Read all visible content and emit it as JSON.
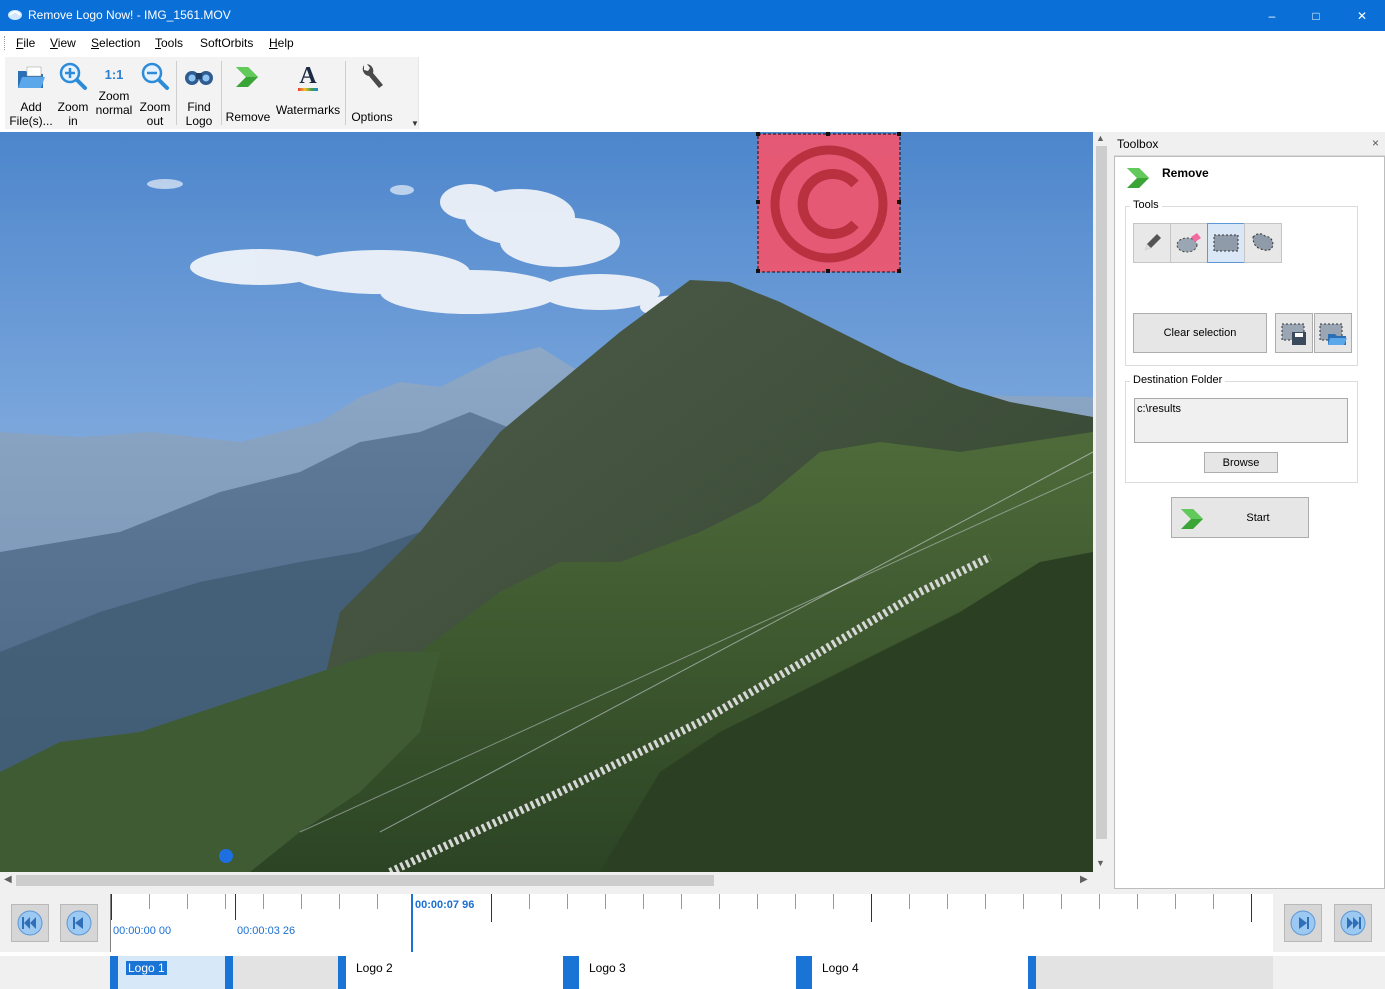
{
  "window": {
    "title": "Remove Logo Now! - IMG_1561.MOV",
    "minimize": "–",
    "maximize": "□",
    "close": "✕"
  },
  "menu": {
    "items": [
      {
        "label": "File",
        "key": "F",
        "rest": "ile"
      },
      {
        "label": "View",
        "key": "V",
        "rest": "iew"
      },
      {
        "label": "Selection",
        "key": "S",
        "rest": "election"
      },
      {
        "label": "Tools",
        "key": "T",
        "rest": "ools"
      },
      {
        "label": "SoftOrbits",
        "key": "",
        "rest": "SoftOrbits"
      },
      {
        "label": "Help",
        "key": "H",
        "rest": "elp"
      }
    ]
  },
  "toolbar": {
    "add_files": {
      "line1": "Add",
      "line2": "File(s)..."
    },
    "zoom_in": {
      "line1": "Zoom",
      "line2": "in"
    },
    "zoom_normal": {
      "icon_text": "1:1",
      "line1": "Zoom",
      "line2": "normal"
    },
    "zoom_out": {
      "line1": "Zoom",
      "line2": "out"
    },
    "find_logo": {
      "line1": "Find",
      "line2": "Logo"
    },
    "remove": {
      "line1": "Remove"
    },
    "watermarks": {
      "line1": "Watermarks",
      "icon_text": "A"
    },
    "options": {
      "line1": "Options"
    },
    "more": "▼"
  },
  "toolbox": {
    "header": "Toolbox",
    "close": "×",
    "title": "Remove",
    "tools_label": "Tools",
    "clear_selection": "Clear selection",
    "destination_label": "Destination Folder",
    "destination_value": "c:\\results",
    "browse": "Browse",
    "start": "Start"
  },
  "scroll": {
    "up": "▲",
    "down": "▼",
    "left": "◀",
    "right": "▶"
  },
  "timeline": {
    "times": [
      "00:00:00 00",
      "00:00:03 26"
    ],
    "current_time": "00:00:07 96",
    "segments": [
      "Logo 1",
      "Logo 2",
      "Logo 3",
      "Logo 4"
    ],
    "selected_segment": "Logo 1"
  },
  "colors": {
    "titlebar": "#0a6fd6",
    "selection_fill": "#f0556e",
    "accent": "#1a74d6",
    "remove_arrow": "#3aa536"
  }
}
